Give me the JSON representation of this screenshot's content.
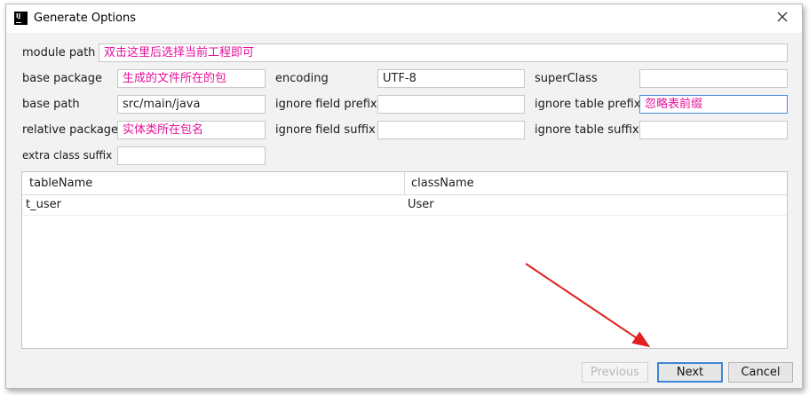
{
  "window": {
    "app_icon_text": "IJ",
    "title": "Generate Options"
  },
  "form": {
    "module_path": {
      "label": "module path",
      "value": "双击这里后选择当前工程即可"
    },
    "base_package": {
      "label": "base package",
      "value": "生成的文件所在的包"
    },
    "encoding": {
      "label": "encoding",
      "value": "UTF-8"
    },
    "super_class": {
      "label": "superClass",
      "value": ""
    },
    "base_path": {
      "label": "base path",
      "value": "src/main/java"
    },
    "ignore_field_prefix": {
      "label": "ignore field prefix",
      "value": ""
    },
    "ignore_table_prefix": {
      "label": "ignore table prefix",
      "value": "忽略表前缀"
    },
    "relative_package": {
      "label": "relative package",
      "value": "实体类所在包名"
    },
    "ignore_field_suffix": {
      "label": "ignore field suffix",
      "value": ""
    },
    "ignore_table_suffix": {
      "label": "ignore table suffix",
      "value": ""
    },
    "extra_class_suffix": {
      "label": "extra class suffix",
      "value": ""
    }
  },
  "table": {
    "columns": [
      "tableName",
      "className"
    ],
    "rows": [
      [
        "t_user",
        "User"
      ]
    ]
  },
  "buttons": {
    "previous": "Previous",
    "next": "Next",
    "cancel": "Cancel"
  },
  "colors": {
    "annotation_text": "#e6119b",
    "focus_border": "#4a8edc",
    "arrow": "#e02020"
  }
}
